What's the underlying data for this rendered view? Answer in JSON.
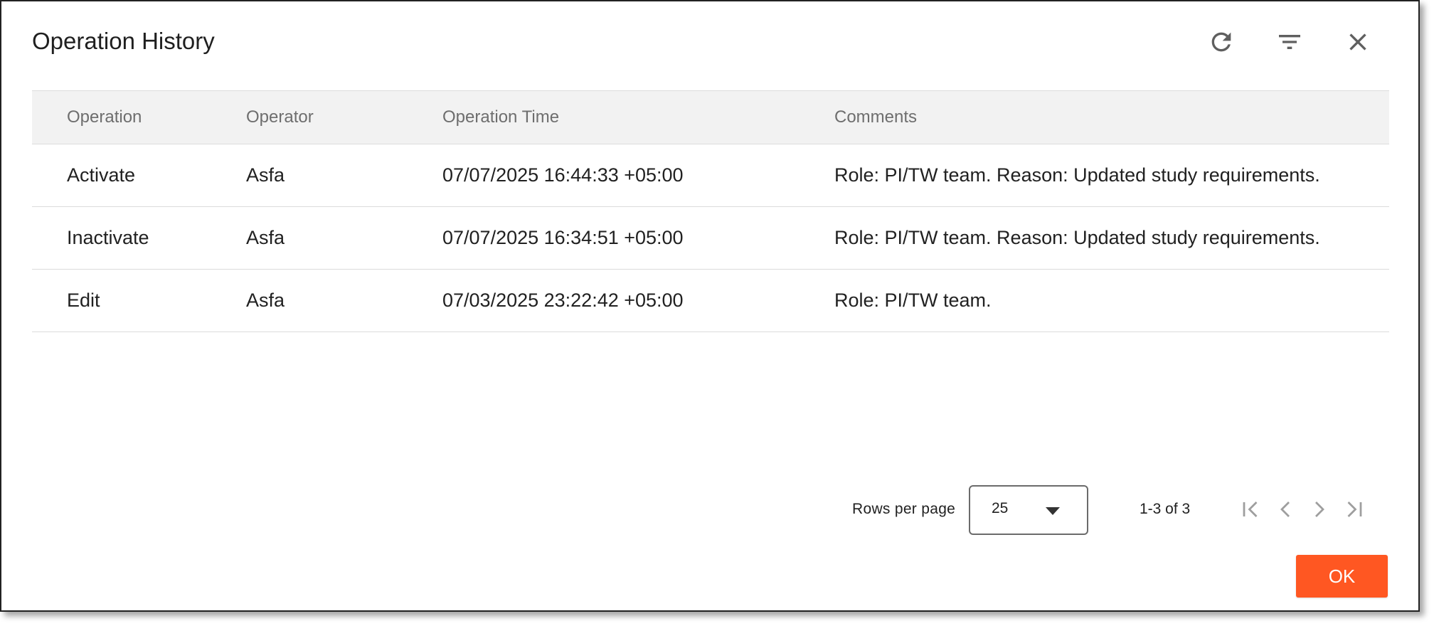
{
  "dialog": {
    "title": "Operation History"
  },
  "header_icons": {
    "refresh": "refresh-icon",
    "filter": "filter-icon",
    "close": "close-icon"
  },
  "table": {
    "columns": [
      "Operation",
      "Operator",
      "Operation Time",
      "Comments"
    ],
    "rows": [
      [
        "Activate",
        "Asfa",
        "07/07/2025 16:44:33 +05:00",
        "Role: PI/TW team. Reason: Updated study requirements."
      ],
      [
        "Inactivate",
        "Asfa",
        "07/07/2025 16:34:51 +05:00",
        "Role: PI/TW team. Reason: Updated study requirements."
      ],
      [
        "Edit",
        "Asfa",
        "07/03/2025 23:22:42 +05:00",
        "Role: PI/TW team."
      ]
    ]
  },
  "pagination": {
    "rows_per_page_label": "Rows per page",
    "rows_per_page_value": "25",
    "range_text": "1-3 of 3"
  },
  "footer": {
    "ok_label": "OK"
  },
  "colors": {
    "accent": "#ff5722",
    "header_bg": "#f2f2f2",
    "divider": "#dcdcdc"
  }
}
